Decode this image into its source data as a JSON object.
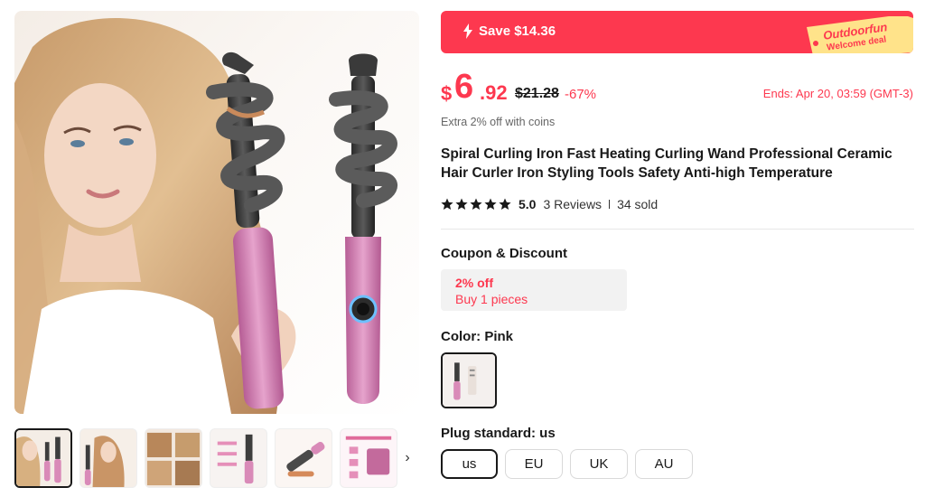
{
  "gallery": {
    "main_image_alt": "",
    "thumbnails": [
      "thumb-1",
      "thumb-2",
      "thumb-3",
      "thumb-4",
      "thumb-5",
      "thumb-6"
    ],
    "next_icon": "chevron-right-icon",
    "next_glyph": "›"
  },
  "promo": {
    "save_text": "Save $14.36",
    "tag_brand": "Outdoorfun",
    "tag_sub": "Welcome deal"
  },
  "price": {
    "currency": "$",
    "integer": "6",
    "decimal": ".92",
    "original": "$21.28",
    "discount": "-67%",
    "ends": "Ends: Apr 20, 03:59 (GMT-3)"
  },
  "coins_text": "Extra 2% off with coins",
  "product_title": "Spiral Curling Iron Fast Heating Curling Wand Professional Ceramic Hair Curler Iron Styling Tools Safety Anti-high Temperature",
  "rating": {
    "value": "5.0",
    "stars": 5,
    "reviews": "3 Reviews",
    "sold": "34 sold"
  },
  "coupon": {
    "label": "Coupon & Discount",
    "off": "2% off",
    "condition": "Buy 1 pieces"
  },
  "color": {
    "label": "Color: Pink"
  },
  "plug": {
    "label": "Plug standard: us",
    "options": [
      "us",
      "EU",
      "UK",
      "AU"
    ],
    "selected": "us"
  },
  "colors": {
    "accent": "#fd384f",
    "tag_yellow": "#ffe38a",
    "text": "#191919",
    "pink": "#d98ab8"
  }
}
